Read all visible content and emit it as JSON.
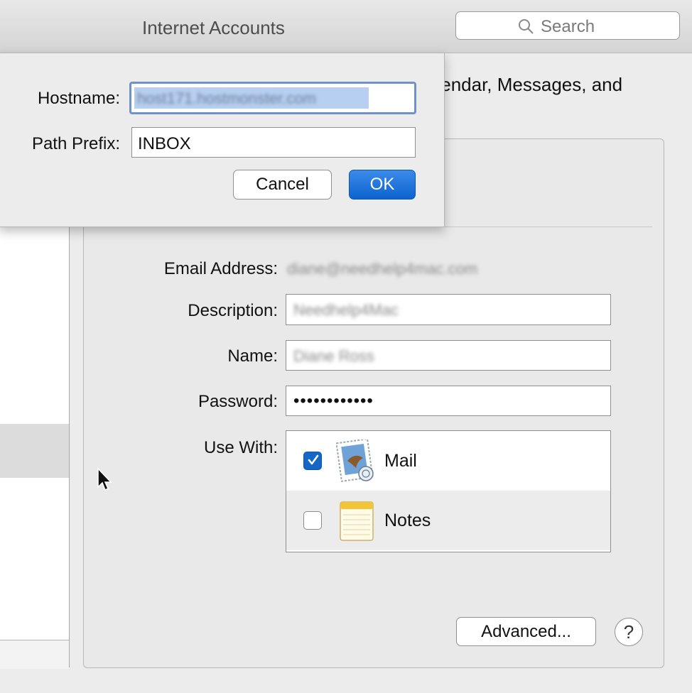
{
  "window": {
    "title": "Internet Accounts"
  },
  "search": {
    "placeholder": "Search"
  },
  "intro": {
    "text_fragment": "alendar, Messages, and"
  },
  "account": {
    "email_label": "Email Address:",
    "email_value": "diane@needhelp4mac.com",
    "description_label": "Description:",
    "description_value": "Needhelp4Mac",
    "name_label": "Name:",
    "name_value": "Diane Ross",
    "password_label": "Password:",
    "password_value": "••••••••••••",
    "use_with_label": "Use With:",
    "use_with": [
      {
        "label": "Mail",
        "checked": true,
        "icon": "mail-stamp-icon"
      },
      {
        "label": "Notes",
        "checked": false,
        "icon": "notes-pad-icon"
      }
    ],
    "advanced_label": "Advanced...",
    "help_label": "?"
  },
  "sheet": {
    "hostname_label": "Hostname:",
    "hostname_value": "host171.hostmonster.com",
    "path_prefix_label": "Path Prefix:",
    "path_prefix_value": "INBOX",
    "cancel_label": "Cancel",
    "ok_label": "OK"
  },
  "colors": {
    "accent": "#1466c7",
    "focus_ring": "#6f93c7"
  }
}
